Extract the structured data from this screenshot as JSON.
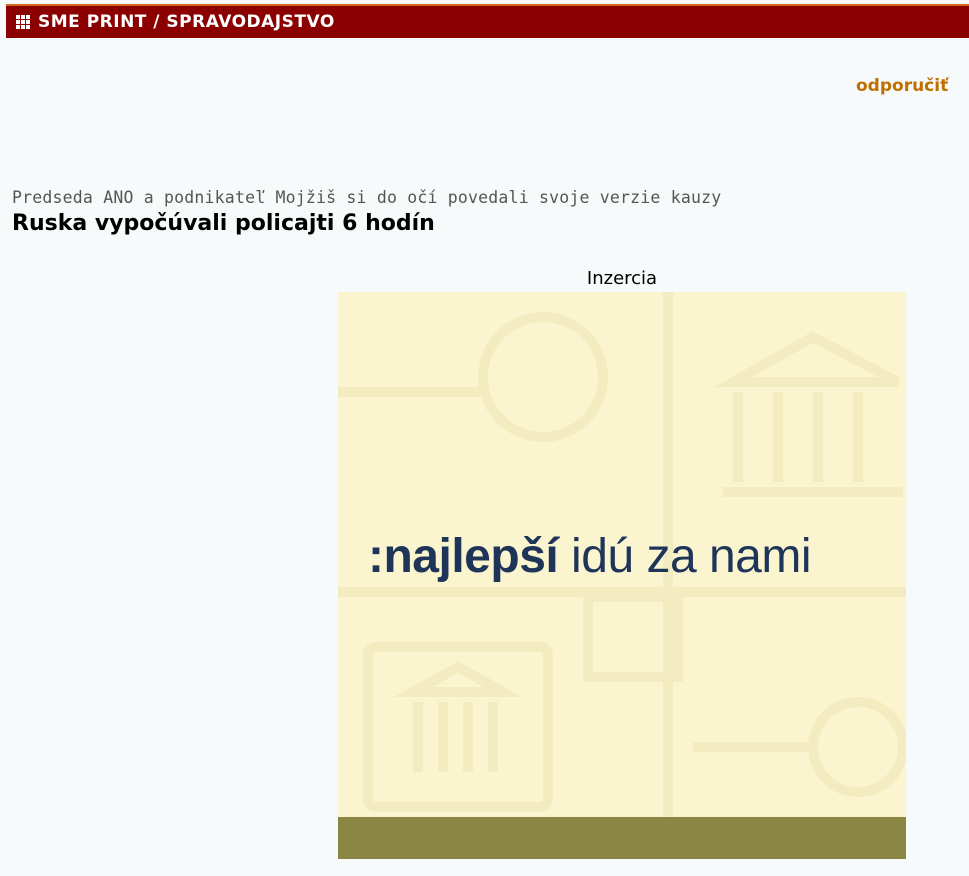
{
  "section_bar": {
    "title": "SME PRINT / SPRAVODAJSTVO",
    "icon": "grid-icon"
  },
  "recommend_link": {
    "label": "odporučiť"
  },
  "article": {
    "subtitle": "Predseda ANO a podnikateľ Mojžiš si do očí povedali svoje verzie kauzy",
    "headline": "Ruska vypočúvali policajti 6 hodín"
  },
  "ad": {
    "label": "Inzercia",
    "slogan_strong": ":najlepší",
    "slogan_rest": " idú za nami",
    "background_color": "#fbf5cf",
    "slogan_color": "#1e3559",
    "band_color": "#8a8744"
  },
  "colors": {
    "section_bar": "#8b0000",
    "link": "#c07000"
  }
}
